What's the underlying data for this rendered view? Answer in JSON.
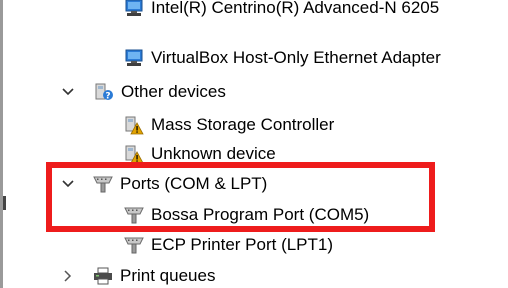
{
  "colors": {
    "highlight": "#ee1c1c",
    "network_icon": "#2b7bd6",
    "warning_icon": "#e2a300"
  },
  "tree": {
    "row0": {
      "label": "Intel(R) Centrino(R) Advanced-N 6205",
      "icon": "network-adapter-icon"
    },
    "row1": {
      "label": "VirtualBox Host-Only Ethernet Adapter",
      "icon": "network-adapter-icon"
    },
    "row2": {
      "label": "Other devices",
      "icon": "unknown-device-category-icon",
      "state": "expanded"
    },
    "row3": {
      "label": "Mass Storage Controller",
      "icon": "warning-device-icon"
    },
    "row4": {
      "label": "Unknown device",
      "icon": "warning-device-icon"
    },
    "row5": {
      "label": "Ports (COM & LPT)",
      "icon": "port-connector-icon",
      "state": "expanded"
    },
    "row6": {
      "label": "Bossa Program Port (COM5)",
      "icon": "port-connector-icon"
    },
    "row7": {
      "label": "ECP Printer Port (LPT1)",
      "icon": "port-connector-icon"
    },
    "row8": {
      "label": "Print queues",
      "icon": "printer-icon",
      "state": "collapsed"
    }
  }
}
